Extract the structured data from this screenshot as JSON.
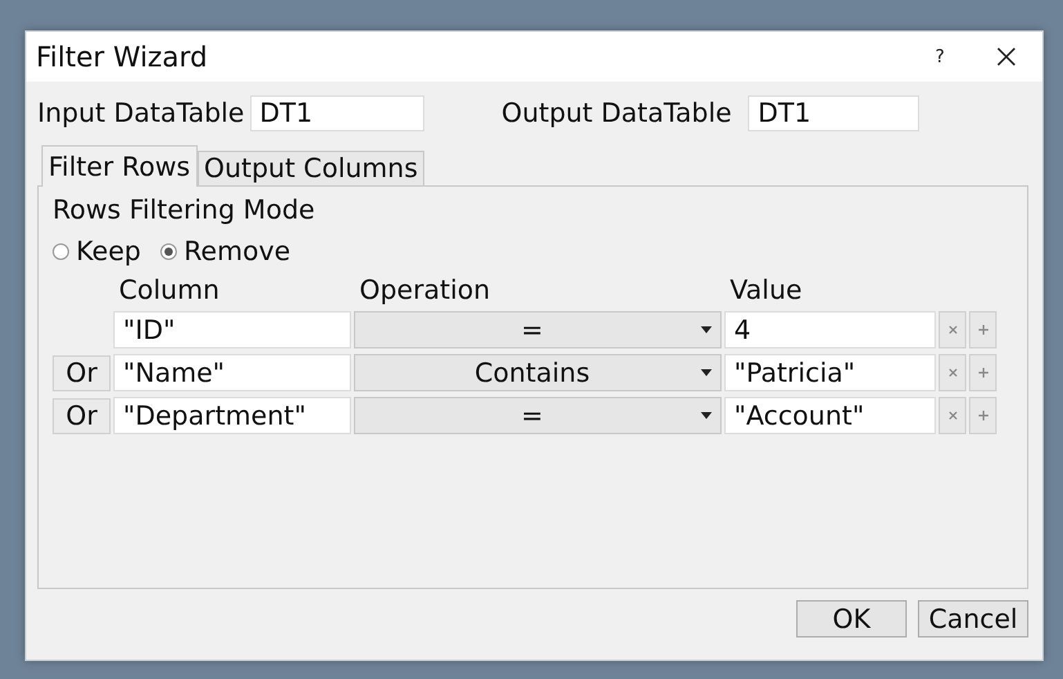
{
  "window": {
    "title": "Filter Wizard",
    "help_button": "?"
  },
  "input": {
    "label": "Input DataTable",
    "value": "DT1"
  },
  "output": {
    "label": "Output DataTable",
    "value": "DT1"
  },
  "tabs": [
    {
      "label": "Filter Rows",
      "selected": true
    },
    {
      "label": "Output Columns",
      "selected": false
    }
  ],
  "mode": {
    "title": "Rows Filtering Mode",
    "options": [
      {
        "label": "Keep",
        "selected": false
      },
      {
        "label": "Remove",
        "selected": true
      }
    ]
  },
  "columns": [
    "Column",
    "Operation",
    "Value"
  ],
  "rows": [
    {
      "column": "\"ID\"",
      "operation": "=",
      "value": "4"
    },
    {
      "connector": "Or",
      "column": "\"Name\"",
      "operation": "Contains",
      "value": "\"Patricia\""
    },
    {
      "connector": "Or",
      "column": "\"Department\"",
      "operation": "=",
      "value": "\"Account\""
    }
  ],
  "buttons": [
    "OK",
    "Cancel"
  ]
}
